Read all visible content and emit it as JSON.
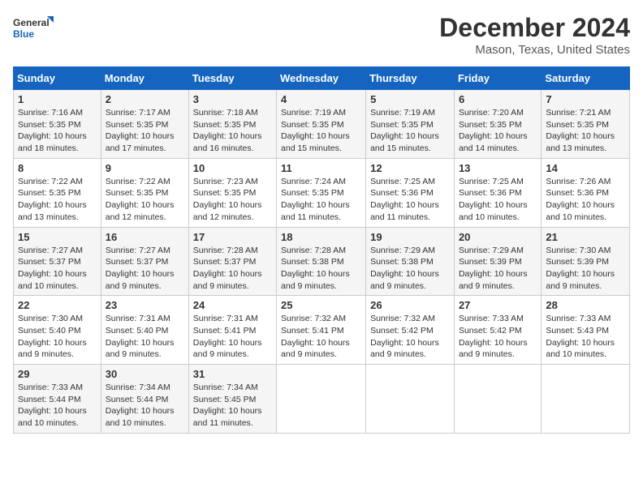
{
  "logo": {
    "line1": "General",
    "line2": "Blue"
  },
  "title": "December 2024",
  "location": "Mason, Texas, United States",
  "days_of_week": [
    "Sunday",
    "Monday",
    "Tuesday",
    "Wednesday",
    "Thursday",
    "Friday",
    "Saturday"
  ],
  "weeks": [
    [
      {
        "day": "1",
        "sunrise": "7:16 AM",
        "sunset": "5:35 PM",
        "daylight": "10 hours and 18 minutes."
      },
      {
        "day": "2",
        "sunrise": "7:17 AM",
        "sunset": "5:35 PM",
        "daylight": "10 hours and 17 minutes."
      },
      {
        "day": "3",
        "sunrise": "7:18 AM",
        "sunset": "5:35 PM",
        "daylight": "10 hours and 16 minutes."
      },
      {
        "day": "4",
        "sunrise": "7:19 AM",
        "sunset": "5:35 PM",
        "daylight": "10 hours and 15 minutes."
      },
      {
        "day": "5",
        "sunrise": "7:19 AM",
        "sunset": "5:35 PM",
        "daylight": "10 hours and 15 minutes."
      },
      {
        "day": "6",
        "sunrise": "7:20 AM",
        "sunset": "5:35 PM",
        "daylight": "10 hours and 14 minutes."
      },
      {
        "day": "7",
        "sunrise": "7:21 AM",
        "sunset": "5:35 PM",
        "daylight": "10 hours and 13 minutes."
      }
    ],
    [
      {
        "day": "8",
        "sunrise": "7:22 AM",
        "sunset": "5:35 PM",
        "daylight": "10 hours and 13 minutes."
      },
      {
        "day": "9",
        "sunrise": "7:22 AM",
        "sunset": "5:35 PM",
        "daylight": "10 hours and 12 minutes."
      },
      {
        "day": "10",
        "sunrise": "7:23 AM",
        "sunset": "5:35 PM",
        "daylight": "10 hours and 12 minutes."
      },
      {
        "day": "11",
        "sunrise": "7:24 AM",
        "sunset": "5:35 PM",
        "daylight": "10 hours and 11 minutes."
      },
      {
        "day": "12",
        "sunrise": "7:25 AM",
        "sunset": "5:36 PM",
        "daylight": "10 hours and 11 minutes."
      },
      {
        "day": "13",
        "sunrise": "7:25 AM",
        "sunset": "5:36 PM",
        "daylight": "10 hours and 10 minutes."
      },
      {
        "day": "14",
        "sunrise": "7:26 AM",
        "sunset": "5:36 PM",
        "daylight": "10 hours and 10 minutes."
      }
    ],
    [
      {
        "day": "15",
        "sunrise": "7:27 AM",
        "sunset": "5:37 PM",
        "daylight": "10 hours and 10 minutes."
      },
      {
        "day": "16",
        "sunrise": "7:27 AM",
        "sunset": "5:37 PM",
        "daylight": "10 hours and 9 minutes."
      },
      {
        "day": "17",
        "sunrise": "7:28 AM",
        "sunset": "5:37 PM",
        "daylight": "10 hours and 9 minutes."
      },
      {
        "day": "18",
        "sunrise": "7:28 AM",
        "sunset": "5:38 PM",
        "daylight": "10 hours and 9 minutes."
      },
      {
        "day": "19",
        "sunrise": "7:29 AM",
        "sunset": "5:38 PM",
        "daylight": "10 hours and 9 minutes."
      },
      {
        "day": "20",
        "sunrise": "7:29 AM",
        "sunset": "5:39 PM",
        "daylight": "10 hours and 9 minutes."
      },
      {
        "day": "21",
        "sunrise": "7:30 AM",
        "sunset": "5:39 PM",
        "daylight": "10 hours and 9 minutes."
      }
    ],
    [
      {
        "day": "22",
        "sunrise": "7:30 AM",
        "sunset": "5:40 PM",
        "daylight": "10 hours and 9 minutes."
      },
      {
        "day": "23",
        "sunrise": "7:31 AM",
        "sunset": "5:40 PM",
        "daylight": "10 hours and 9 minutes."
      },
      {
        "day": "24",
        "sunrise": "7:31 AM",
        "sunset": "5:41 PM",
        "daylight": "10 hours and 9 minutes."
      },
      {
        "day": "25",
        "sunrise": "7:32 AM",
        "sunset": "5:41 PM",
        "daylight": "10 hours and 9 minutes."
      },
      {
        "day": "26",
        "sunrise": "7:32 AM",
        "sunset": "5:42 PM",
        "daylight": "10 hours and 9 minutes."
      },
      {
        "day": "27",
        "sunrise": "7:33 AM",
        "sunset": "5:42 PM",
        "daylight": "10 hours and 9 minutes."
      },
      {
        "day": "28",
        "sunrise": "7:33 AM",
        "sunset": "5:43 PM",
        "daylight": "10 hours and 10 minutes."
      }
    ],
    [
      {
        "day": "29",
        "sunrise": "7:33 AM",
        "sunset": "5:44 PM",
        "daylight": "10 hours and 10 minutes."
      },
      {
        "day": "30",
        "sunrise": "7:34 AM",
        "sunset": "5:44 PM",
        "daylight": "10 hours and 10 minutes."
      },
      {
        "day": "31",
        "sunrise": "7:34 AM",
        "sunset": "5:45 PM",
        "daylight": "10 hours and 11 minutes."
      },
      null,
      null,
      null,
      null
    ]
  ]
}
